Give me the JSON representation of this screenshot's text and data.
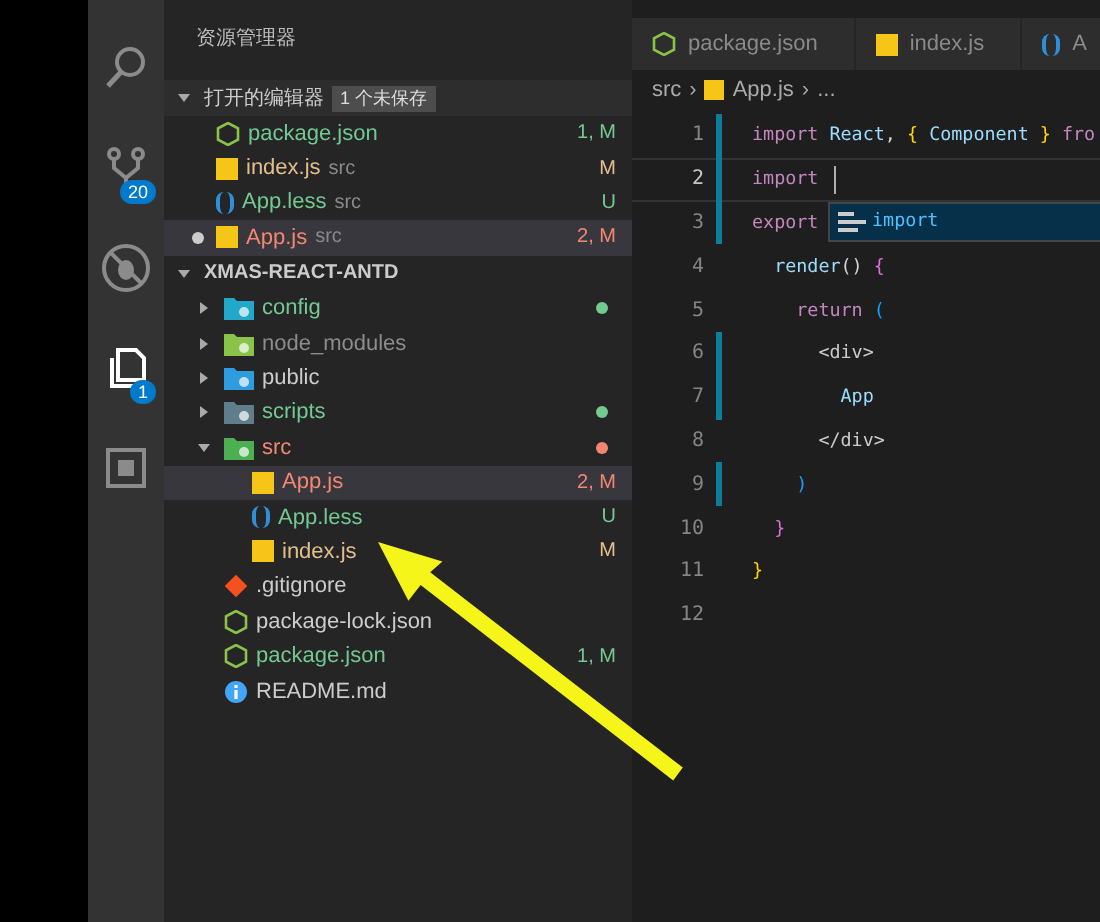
{
  "activity_bar": [
    {
      "kind": "search",
      "selected": false
    },
    {
      "kind": "source-control",
      "badge": "20",
      "selected": false
    },
    {
      "kind": "debug",
      "selected": false
    },
    {
      "kind": "explorer",
      "badge": "1",
      "selected": true
    },
    {
      "kind": "extensions",
      "selected": false
    }
  ],
  "sidebar": {
    "title": "资源管理器",
    "open_editors": {
      "label": "打开的编辑器",
      "badge": "1 个未保存",
      "expanded": true,
      "items": [
        {
          "kind": "json",
          "name": "package.json",
          "status": "1, M",
          "color": "#73c991",
          "dirty": false,
          "selected": false
        },
        {
          "kind": "js",
          "name": "index.js",
          "path": "src",
          "status": "M",
          "color": "#e2c08d",
          "dirty": false,
          "selected": false
        },
        {
          "kind": "less",
          "name": "App.less",
          "path": "src",
          "status": "U",
          "color": "#73c991",
          "dirty": false,
          "selected": false
        },
        {
          "kind": "js",
          "name": "App.js",
          "path": "src",
          "status": "2, M",
          "color": "#f48771",
          "dirty": true,
          "selected": true
        }
      ]
    },
    "project": {
      "label": "XMAS-REACT-ANTD",
      "expanded": true,
      "children": [
        {
          "kind": "folder",
          "name": "config",
          "color": "#73c991",
          "has_changes": true,
          "expanded": false,
          "selected": false
        },
        {
          "kind": "folder",
          "name": "node_modules",
          "color": "#8c8c8c",
          "has_changes": false,
          "expanded": false,
          "selected": false
        },
        {
          "kind": "folder",
          "name": "public",
          "color": "#cccccc",
          "has_changes": false,
          "expanded": false,
          "selected": false
        },
        {
          "kind": "folder",
          "name": "scripts",
          "color": "#73c991",
          "has_changes": true,
          "expanded": false,
          "selected": false
        },
        {
          "kind": "folder",
          "name": "src",
          "color": "#f48771",
          "has_changes": true,
          "expanded": true,
          "selected": false,
          "children": [
            {
              "kind": "js",
              "name": "App.js",
              "status": "2, M",
              "color": "#f48771",
              "selected": true
            },
            {
              "kind": "less",
              "name": "App.less",
              "status": "U",
              "color": "#73c991",
              "selected": false
            },
            {
              "kind": "js",
              "name": "index.js",
              "status": "M",
              "color": "#e2c08d",
              "selected": false
            }
          ]
        },
        {
          "kind": "git",
          "name": ".gitignore",
          "color": "#cccccc",
          "selected": false
        },
        {
          "kind": "json",
          "name": "package-lock.json",
          "color": "#cccccc",
          "selected": false
        },
        {
          "kind": "json",
          "name": "package.json",
          "status": "1, M",
          "color": "#73c991",
          "selected": false
        },
        {
          "kind": "info",
          "name": "README.md",
          "color": "#cccccc",
          "selected": false
        }
      ]
    }
  },
  "editor": {
    "tabs": [
      {
        "kind": "json",
        "label": "package.json",
        "selected": false
      },
      {
        "kind": "js",
        "label": "index.js",
        "selected": false
      },
      {
        "kind": "less",
        "label": "A",
        "selected": false
      }
    ],
    "breadcrumb": [
      {
        "kind": "text",
        "text": "src"
      },
      {
        "kind": "sep",
        "text": "›"
      },
      {
        "kind": "js",
        "text": "App.js"
      },
      {
        "kind": "sep",
        "text": "›"
      },
      {
        "kind": "text",
        "text": "..."
      }
    ],
    "lines": [
      {
        "number": "1",
        "changed": true,
        "current": false,
        "tokens": [
          {
            "kind": "kw",
            "text": "import"
          },
          {
            "kind": "id",
            "text": " React"
          },
          {
            "kind": "punct",
            "text": ", "
          },
          {
            "kind": "brace",
            "text": "{"
          },
          {
            "kind": "id",
            "text": " Component "
          },
          {
            "kind": "brace",
            "text": "}"
          },
          {
            "kind": "kw",
            "text": " fro"
          }
        ]
      },
      {
        "number": "2",
        "changed": true,
        "current": true,
        "tokens": [
          {
            "kind": "kw",
            "text": "import"
          }
        ]
      },
      {
        "number": "3",
        "changed": true,
        "current": false,
        "tokens": [
          {
            "kind": "kw",
            "text": "export"
          }
        ],
        "suggestion": "import"
      },
      {
        "number": "4",
        "changed": false,
        "current": false,
        "tokens": [
          {
            "kind": "id",
            "text": "  render"
          },
          {
            "kind": "punct",
            "text": "() "
          },
          {
            "kind": "brace2",
            "text": "{"
          }
        ]
      },
      {
        "number": "5",
        "changed": false,
        "current": false,
        "tokens": [
          {
            "kind": "kw",
            "text": "    return"
          },
          {
            "kind": "brace3",
            "text": " ("
          }
        ]
      },
      {
        "number": "6",
        "changed": true,
        "current": false,
        "tokens": [
          {
            "kind": "tag",
            "text": "      <div>"
          }
        ]
      },
      {
        "number": "7",
        "changed": true,
        "current": false,
        "tokens": [
          {
            "kind": "id",
            "text": "        App"
          }
        ]
      },
      {
        "number": "8",
        "changed": false,
        "current": false,
        "tokens": [
          {
            "kind": "tag",
            "text": "      </div>"
          }
        ]
      },
      {
        "number": "9",
        "changed": true,
        "current": false,
        "tokens": [
          {
            "kind": "brace3",
            "text": "    )"
          }
        ]
      },
      {
        "number": "10",
        "changed": false,
        "current": false,
        "tokens": [
          {
            "kind": "brace2",
            "text": "  }"
          }
        ]
      },
      {
        "number": "11",
        "changed": false,
        "current": false,
        "tokens": [
          {
            "kind": "brace",
            "text": "}"
          }
        ]
      },
      {
        "number": "12",
        "changed": false,
        "current": false
      }
    ]
  }
}
